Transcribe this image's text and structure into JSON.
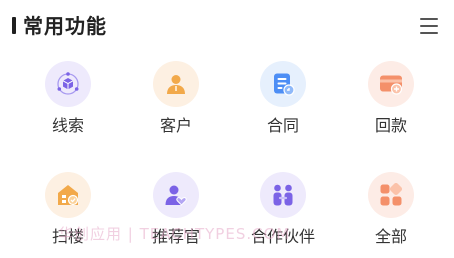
{
  "header": {
    "title": "常用功能",
    "menu_icon": "hamburger-menu-icon"
  },
  "functions": [
    {
      "label": "线索",
      "icon": "cube-network-icon",
      "bg": "#eeeafc",
      "accent": "#7b63e6"
    },
    {
      "label": "客户",
      "icon": "user-icon",
      "bg": "#fdf0e2",
      "accent": "#f2a94a"
    },
    {
      "label": "合同",
      "icon": "document-icon",
      "bg": "#e6f0fd",
      "accent": "#4d8ef5"
    },
    {
      "label": "回款",
      "icon": "card-payment-icon",
      "bg": "#fdece6",
      "accent": "#f4906a"
    },
    {
      "label": "扫楼",
      "icon": "building-icon",
      "bg": "#fdf0e2",
      "accent": "#f2a94a"
    },
    {
      "label": "推荐官",
      "icon": "user-heart-icon",
      "bg": "#eeeafc",
      "accent": "#7b63e6"
    },
    {
      "label": "合作伙伴",
      "icon": "partners-icon",
      "bg": "#eeeafc",
      "accent": "#7b63e6"
    },
    {
      "label": "全部",
      "icon": "all-apps-icon",
      "bg": "#fdece6",
      "accent": "#f4906a"
    }
  ],
  "watermark": "华创应用 | TEACHTYPES.COM"
}
